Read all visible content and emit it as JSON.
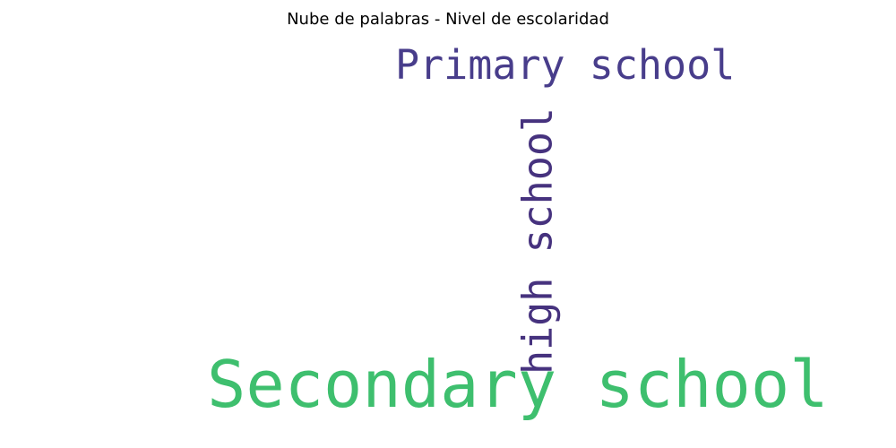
{
  "title": "Nube de palabras - Nivel de escolaridad",
  "words": [
    {
      "text": "Primary school",
      "color": "#483d8b"
    },
    {
      "text": "high school",
      "color": "#46327e"
    },
    {
      "text": "Secondary school",
      "color": "#3ebf6e"
    }
  ]
}
